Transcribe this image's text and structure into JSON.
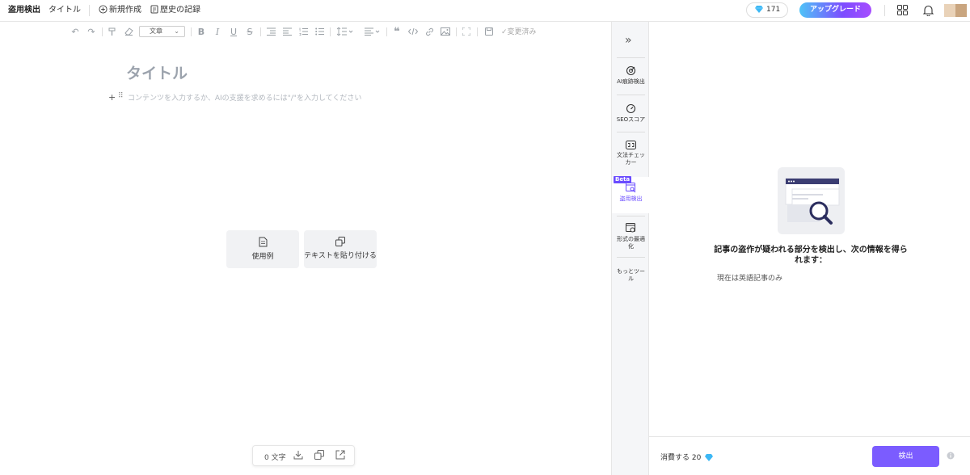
{
  "header": {
    "app_name": "盗用検出",
    "doc_title": "タイトル",
    "new_label": "新規作成",
    "history_label": "歴史の記録",
    "credits": "171",
    "upgrade_label": "アップグレード"
  },
  "toolbar": {
    "style_select": "文章",
    "saved_label": "変更済み",
    "icons": [
      "undo-icon",
      "redo-icon",
      "format-painter-icon",
      "eraser-icon",
      "bold-icon",
      "italic-icon",
      "underline-icon",
      "strikethrough-icon",
      "indent-icon",
      "outdent-icon",
      "ordered-list-icon",
      "bullet-list-icon",
      "line-height-icon",
      "align-icon",
      "quote-icon",
      "code-icon",
      "link-icon",
      "image-icon",
      "fullscreen-icon",
      "save-icon",
      "check-icon"
    ]
  },
  "editor": {
    "title_placeholder": "タイトル",
    "content_placeholder": "コンテンツを入力するか、AIの支援を求めるには\"/\"を入力してください",
    "card_example": "使用例",
    "card_paste": "テキストを貼り付ける",
    "word_count": "0 文字"
  },
  "sidebar": {
    "items": [
      {
        "label": "AI痕跡検出",
        "icon": "ai-detect-icon"
      },
      {
        "label": "SEOスコア",
        "icon": "gauge-icon"
      },
      {
        "label": "文法チェッカー",
        "icon": "grammar-icon"
      },
      {
        "label": "盗用検出",
        "icon": "plagiarism-icon",
        "badge": "Beta",
        "active": true
      },
      {
        "label": "形式の最適化",
        "icon": "format-icon"
      },
      {
        "label": "もっとツール",
        "icon": ""
      }
    ]
  },
  "panel": {
    "heading": "記事の盗作が疑われる部分を検出し、次の情報を得られます：",
    "note": "現在は英語記事のみ",
    "consume_label": "消費する 20",
    "detect_label": "検出"
  },
  "colors": {
    "accent": "#7b5cff",
    "active_text": "#6a4cff",
    "diamond": "#3db8f5"
  }
}
